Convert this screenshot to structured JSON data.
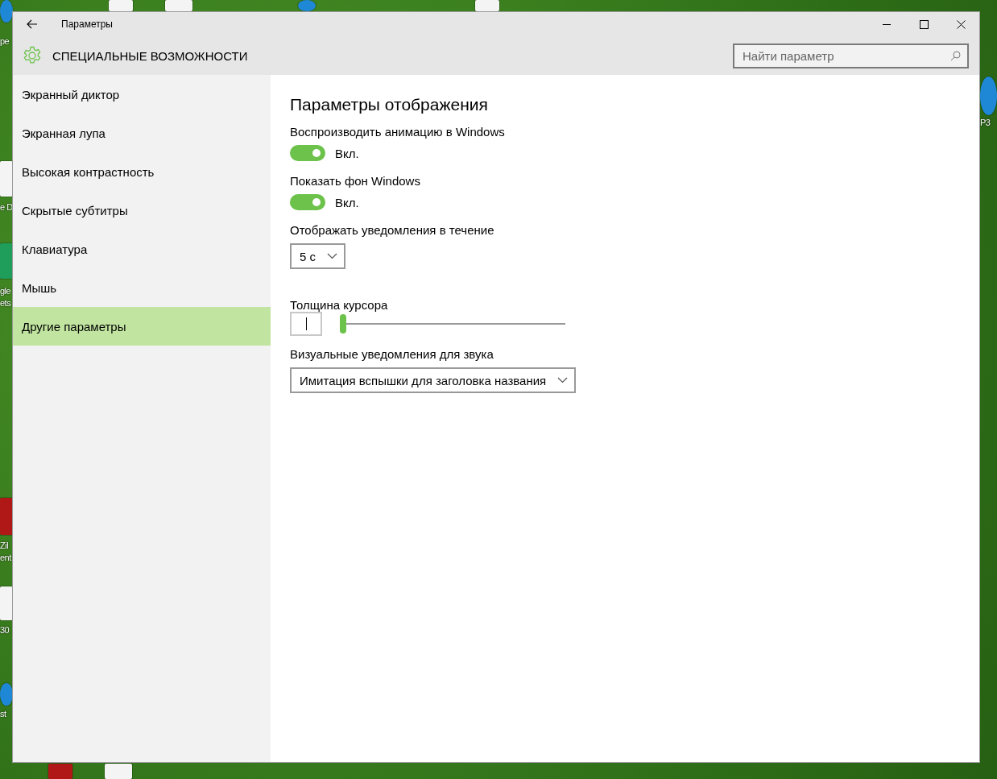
{
  "desktop": {
    "icons": [
      {
        "kind": "round",
        "label": [
          "pe"
        ]
      },
      {
        "kind": "document",
        "label": [
          "e D"
        ]
      },
      {
        "kind": "sheet",
        "label": [
          "gle",
          "ets"
        ]
      },
      {
        "kind": "square",
        "label": [
          "Zil",
          "ent"
        ]
      },
      {
        "kind": "document",
        "label": [
          "30"
        ]
      },
      {
        "kind": "round",
        "label": [
          "st"
        ]
      },
      {
        "kind": "round",
        "label": [
          "P3"
        ]
      },
      {
        "kind": "document"
      },
      {
        "kind": "document"
      },
      {
        "kind": "round"
      },
      {
        "kind": "document"
      },
      {
        "kind": "square"
      },
      {
        "kind": "document"
      }
    ]
  },
  "window": {
    "title": "Параметры",
    "heading": "СПЕЦИАЛЬНЫЕ ВОЗМОЖНОСТИ",
    "search": {
      "placeholder": "Найти параметр"
    }
  },
  "sidebar": {
    "items": [
      {
        "label": "Экранный диктор",
        "selected": false
      },
      {
        "label": "Экранная лупа",
        "selected": false
      },
      {
        "label": "Высокая контрастность",
        "selected": false
      },
      {
        "label": "Скрытые субтитры",
        "selected": false
      },
      {
        "label": "Клавиатура",
        "selected": false
      },
      {
        "label": "Мышь",
        "selected": false
      },
      {
        "label": "Другие параметры",
        "selected": true
      }
    ]
  },
  "content": {
    "title": "Параметры отображения",
    "settings": [
      {
        "kind": "toggle",
        "label": "Воспроизводить анимацию в Windows",
        "on": true,
        "state_text": "Вкл."
      },
      {
        "kind": "toggle",
        "label": "Показать фон Windows",
        "on": true,
        "state_text": "Вкл."
      },
      {
        "kind": "dropdown",
        "label": "Отображать уведомления в течение",
        "value": "5 с"
      },
      {
        "kind": "slider",
        "label": "Толщина курсора",
        "level": 0
      },
      {
        "kind": "dropdown",
        "label": "Визуальные уведомления для звука",
        "value": "Имитация вспышки для заголовка названия"
      }
    ]
  }
}
